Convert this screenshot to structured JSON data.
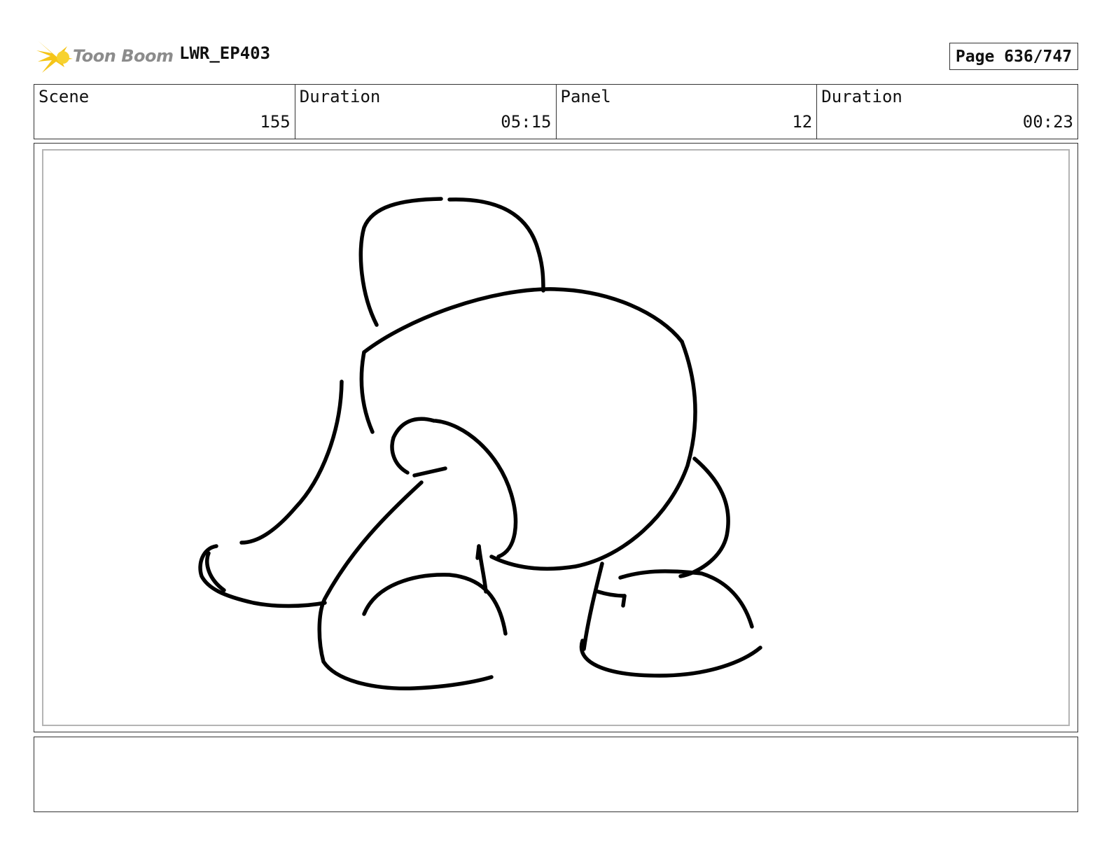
{
  "header": {
    "logo_text": "Toon Boom",
    "project": "LWR_EP403",
    "page": "Page 636/747"
  },
  "info": {
    "scene_label": "Scene",
    "scene_value": "155",
    "duration_label": "Duration",
    "duration_value": "05:15",
    "panel_label": "Panel",
    "panel_value": "12",
    "panel_duration_label": "Duration",
    "panel_duration_value": "00:23"
  },
  "colors": {
    "logo_burst": "#f5c518",
    "logo_text": "#8c8c8c",
    "frame_border": "#333333",
    "safe_border": "#b4b4b4"
  },
  "icons": {
    "logo": "starburst-icon"
  },
  "notes": {
    "text": ""
  }
}
